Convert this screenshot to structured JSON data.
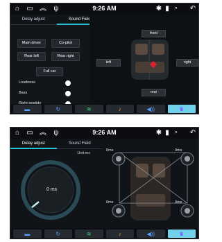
{
  "screen_a": {
    "status": {
      "time": "9:26 AM"
    },
    "tabs": [
      {
        "label": "Delay adjust"
      },
      {
        "label": "Sound Field"
      }
    ],
    "seat_buttons": {
      "main_driver": "Main driver",
      "co_pilot": "Co-pilot",
      "rear_left": "Rear left",
      "rear_right": "Rear right",
      "full_car": "Full car"
    },
    "options": [
      {
        "label": "Loudness",
        "on": true
      },
      {
        "label": "Bass",
        "on": true
      },
      {
        "label": "Right peptide",
        "on": true
      }
    ],
    "field_buttons": {
      "front": "front",
      "rear": "rear",
      "left": "left",
      "right": "right"
    },
    "dock": [
      {
        "icon": "save-icon"
      },
      {
        "icon": "reset-icon"
      },
      {
        "icon": "eq-icon"
      },
      {
        "icon": "tone-icon"
      },
      {
        "icon": "volume-icon"
      },
      {
        "icon": "crown-icon",
        "active": true
      }
    ]
  },
  "screen_b": {
    "status": {
      "time": "9:26 AM"
    },
    "tabs": [
      {
        "label": "Delay adjust"
      },
      {
        "label": "Sound Field"
      }
    ],
    "unit_label": "Unit:ms",
    "dial_value": "0 ms",
    "speakers": {
      "front_left": "0ms",
      "front_right": "0ms",
      "rear_left": "0ms",
      "rear_right": "0ms"
    },
    "dock": [
      {
        "icon": "save-icon"
      },
      {
        "icon": "reset-icon"
      },
      {
        "icon": "eq-icon"
      },
      {
        "icon": "tone-icon"
      },
      {
        "icon": "volume-icon"
      },
      {
        "icon": "crown-icon",
        "active": true
      }
    ]
  },
  "colors": {
    "accent": "#27c3d8",
    "marker": "#e0202a",
    "bg": "#101419"
  }
}
